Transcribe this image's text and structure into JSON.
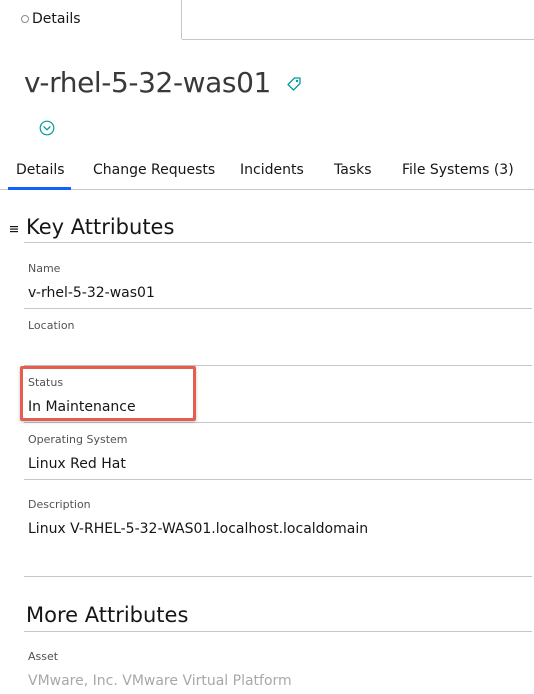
{
  "top_tab": {
    "label": "Details"
  },
  "record": {
    "title": "v-rhel-5-32-was01"
  },
  "tabs": [
    {
      "label": "Details"
    },
    {
      "label": "Change Requests"
    },
    {
      "label": "Incidents"
    },
    {
      "label": "Tasks"
    },
    {
      "label": "File Systems (3)"
    }
  ],
  "key_attributes": {
    "title": "Key Attributes",
    "fields": [
      {
        "label": "Name",
        "value": "v-rhel-5-32-was01"
      },
      {
        "label": "Location",
        "value": ""
      },
      {
        "label": "Status",
        "value": "In Maintenance"
      },
      {
        "label": "Operating System",
        "value": "Linux Red Hat"
      },
      {
        "label": "Description",
        "value": "Linux V-RHEL-5-32-WAS01.localhost.localdomain"
      }
    ]
  },
  "more_attributes": {
    "title": "More Attributes",
    "fields": [
      {
        "label": "Asset",
        "value": "VMware, Inc. VMware Virtual Platform"
      }
    ]
  },
  "colors": {
    "accent": "#0f62fe",
    "highlight": "#e55d4e"
  },
  "icons": [
    "tag-icon",
    "chevron-down-circle-icon",
    "menu-icon"
  ]
}
